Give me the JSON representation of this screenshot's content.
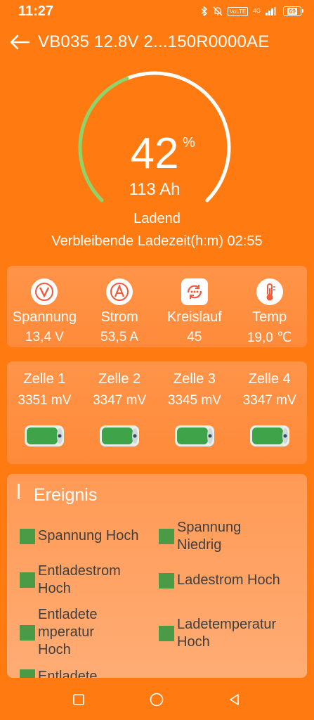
{
  "status_bar": {
    "time": "11:27",
    "volte_label": "VoLTE",
    "network_label": "4G",
    "battery_level": "69",
    "icons": [
      "bluetooth-icon",
      "mute-icon",
      "signal-icon",
      "battery-icon"
    ]
  },
  "header": {
    "title": "VB035 12.8V 2...150R0000AE",
    "back_icon": "arrow-left-icon"
  },
  "gauge": {
    "percent": "42",
    "percent_sign": "%",
    "fill_fraction": 0.42,
    "capacity": "113 Ah",
    "state": "Ladend",
    "remaining_label": "Verbleibende Ladezeit(h:m) 02:55",
    "colors": {
      "fill": "#8fd36a",
      "track": "#ffffff"
    }
  },
  "stats": [
    {
      "icon": "voltage-icon",
      "icon_text": "V",
      "label": "Spannung",
      "value": "13,4 V"
    },
    {
      "icon": "current-icon",
      "icon_text": "A",
      "label": "Strom",
      "value": "53,5 A"
    },
    {
      "icon": "cycle-icon",
      "icon_text": "",
      "label": "Kreislauf",
      "value": "45"
    },
    {
      "icon": "thermometer-icon",
      "icon_text": "",
      "label": "Temp",
      "value": "19,0 ℃"
    }
  ],
  "cells": [
    {
      "label": "Zelle 1",
      "value": "3351 mV"
    },
    {
      "label": "Zelle 2",
      "value": "3347 mV"
    },
    {
      "label": "Zelle 3",
      "value": "3345 mV"
    },
    {
      "label": "Zelle 4",
      "value": "3347 mV"
    }
  ],
  "events": {
    "title": "Ereignis",
    "items": [
      {
        "label_lines": [
          "Spannung Hoch"
        ]
      },
      {
        "label_lines": [
          "Spannung",
          "Niedrig"
        ]
      },
      {
        "label_lines": [
          "Entladestrom",
          "Hoch"
        ]
      },
      {
        "label_lines": [
          "Ladestrom Hoch"
        ]
      },
      {
        "label_lines": [
          "Entladete",
          "mperatur",
          "Hoch"
        ]
      },
      {
        "label_lines": [
          "Ladetemperatur",
          "Hoch"
        ]
      },
      {
        "label_lines": [
          "Entladete"
        ]
      }
    ],
    "indicator_color": "#4a9a46"
  },
  "nav": {
    "icons": [
      "recent-apps-icon",
      "home-icon",
      "back-icon"
    ]
  }
}
